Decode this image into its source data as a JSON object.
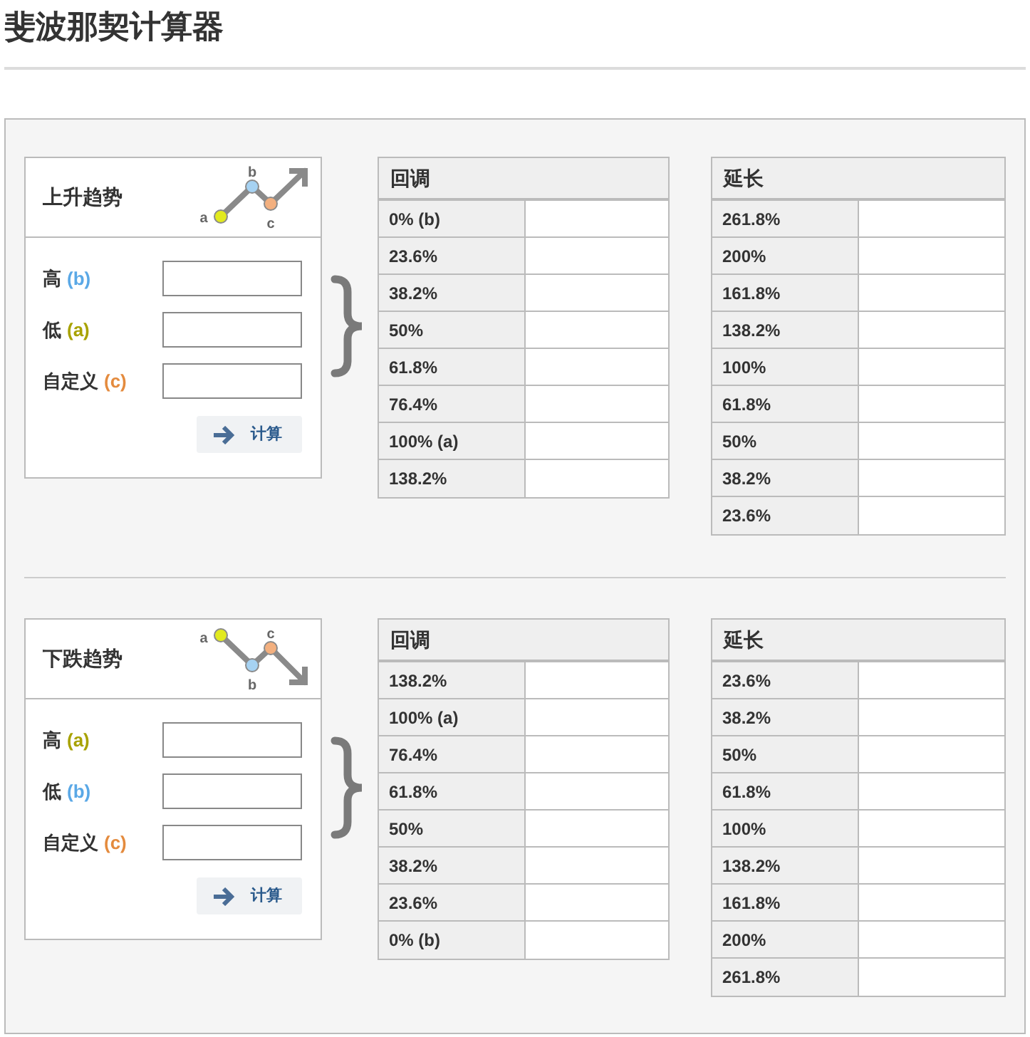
{
  "title": "斐波那契计算器",
  "sections": [
    {
      "kind": "up",
      "heading": "上升趋势",
      "points": [
        {
          "label": "a",
          "color": "#e2ea1f"
        },
        {
          "label": "b",
          "color": "#a6d2f2"
        },
        {
          "label": "c",
          "color": "#f3b07f"
        }
      ],
      "fields": [
        {
          "label": "高",
          "tag": "(b)",
          "color": "#5aa8e6"
        },
        {
          "label": "低",
          "tag": "(a)",
          "color": "#a8a200"
        },
        {
          "label": "自定义",
          "tag": "(c)",
          "color": "#e48b3e"
        }
      ],
      "button": "计算",
      "tables": [
        {
          "title": "回调",
          "rows": [
            "0% (b)",
            "23.6%",
            "38.2%",
            "50%",
            "61.8%",
            "76.4%",
            "100% (a)",
            "138.2%"
          ]
        },
        {
          "title": "延长",
          "rows": [
            "261.8%",
            "200%",
            "161.8%",
            "138.2%",
            "100%",
            "61.8%",
            "50%",
            "38.2%",
            "23.6%"
          ]
        }
      ]
    },
    {
      "kind": "down",
      "heading": "下跌趋势",
      "points": [
        {
          "label": "a",
          "color": "#e2ea1f"
        },
        {
          "label": "b",
          "color": "#a6d2f2"
        },
        {
          "label": "c",
          "color": "#f3b07f"
        }
      ],
      "fields": [
        {
          "label": "高",
          "tag": "(a)",
          "color": "#a8a200"
        },
        {
          "label": "低",
          "tag": "(b)",
          "color": "#5aa8e6"
        },
        {
          "label": "自定义",
          "tag": "(c)",
          "color": "#e48b3e"
        }
      ],
      "button": "计算",
      "tables": [
        {
          "title": "回调",
          "rows": [
            "138.2%",
            "100% (a)",
            "76.4%",
            "61.8%",
            "50%",
            "38.2%",
            "23.6%",
            "0% (b)"
          ]
        },
        {
          "title": "延长",
          "rows": [
            "23.6%",
            "38.2%",
            "50%",
            "61.8%",
            "100%",
            "138.2%",
            "161.8%",
            "200%",
            "261.8%"
          ]
        }
      ]
    }
  ]
}
